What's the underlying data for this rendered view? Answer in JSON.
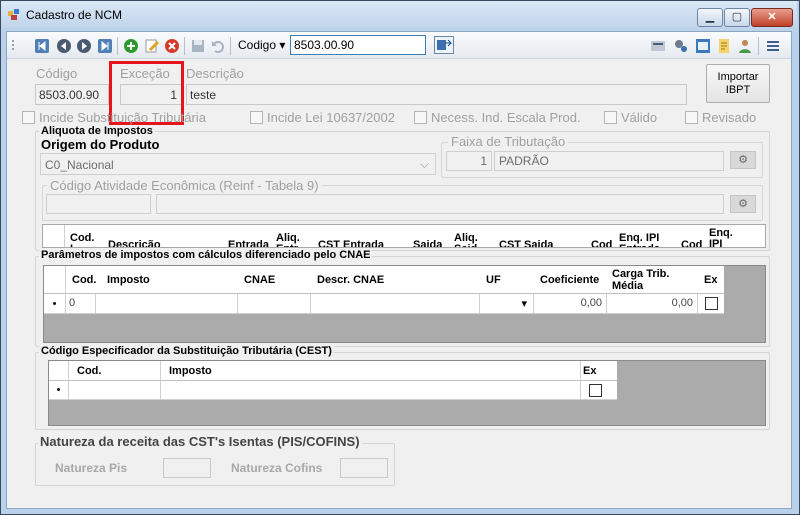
{
  "window": {
    "title": "Cadastro de NCM",
    "minimize": "▁",
    "maximize": "▢",
    "close": "✕"
  },
  "toolbar": {
    "codigo_label": "Codigo",
    "codigo_arrow": "▾",
    "codigo_value": "8503.00.90"
  },
  "header": {
    "codigo_label": "Código",
    "codigo_value": "8503.00.90",
    "excecao_label": "Exceção",
    "excecao_value": "1",
    "descricao_label": "Descrição",
    "descricao_value": "teste",
    "importar_line1": "Importar",
    "importar_line2": "IBPT"
  },
  "checks": {
    "incide_st": "Incide Substituição Tributária",
    "incide_lei": "Incide Lei 10637/2002",
    "necess_escala": "Necess. Ind. Escala Prod.",
    "valido": "Válido",
    "revisado": "Revisado"
  },
  "aliquota": {
    "title": "Aliquota de Impostos",
    "origem_label": "Origem do Produto",
    "origem_value": "C0_Nacional",
    "faixa_label": "Faixa de Tributação",
    "faixa_num": "1",
    "faixa_value": "PADRÃO",
    "atividade_label": "Código Atividade Econômica (Reinf - Tabela 9)",
    "columns": [
      "Cod. I",
      "Descrição",
      "Entrada",
      "Aliq. Entr.",
      "CST Entrada",
      "Saida",
      "Aliq. Said.",
      "CST Saida",
      "Cod",
      "Enq. IPI Entrada",
      "Cod",
      "Enq. IPI"
    ]
  },
  "parametros": {
    "title": "Parâmetros de impostos com cálculos diferenciado pelo CNAE",
    "columns": [
      "Cod.",
      "Imposto",
      "CNAE",
      "Descr. CNAE",
      "UF",
      "Coeficiente",
      "Carga Trib. Média",
      "Ex"
    ],
    "row": {
      "marker": "•",
      "cod": "0",
      "uf_arrow": "▾",
      "coeficiente": "0,00",
      "carga": "0,00"
    }
  },
  "cest": {
    "title": "Código Especificador da Substituição Tributária (CEST)",
    "columns": [
      "Cod.",
      "Imposto",
      "Ex"
    ],
    "row": {
      "marker": "•"
    }
  },
  "natureza": {
    "title": "Natureza da receita das CST's Isentas (PIS/COFINS)",
    "pis_label": "Natureza Pis",
    "cofins_label": "Natureza Cofins"
  },
  "colors": {
    "highlight": "#e8141c",
    "grid_gray": "#ababab"
  }
}
